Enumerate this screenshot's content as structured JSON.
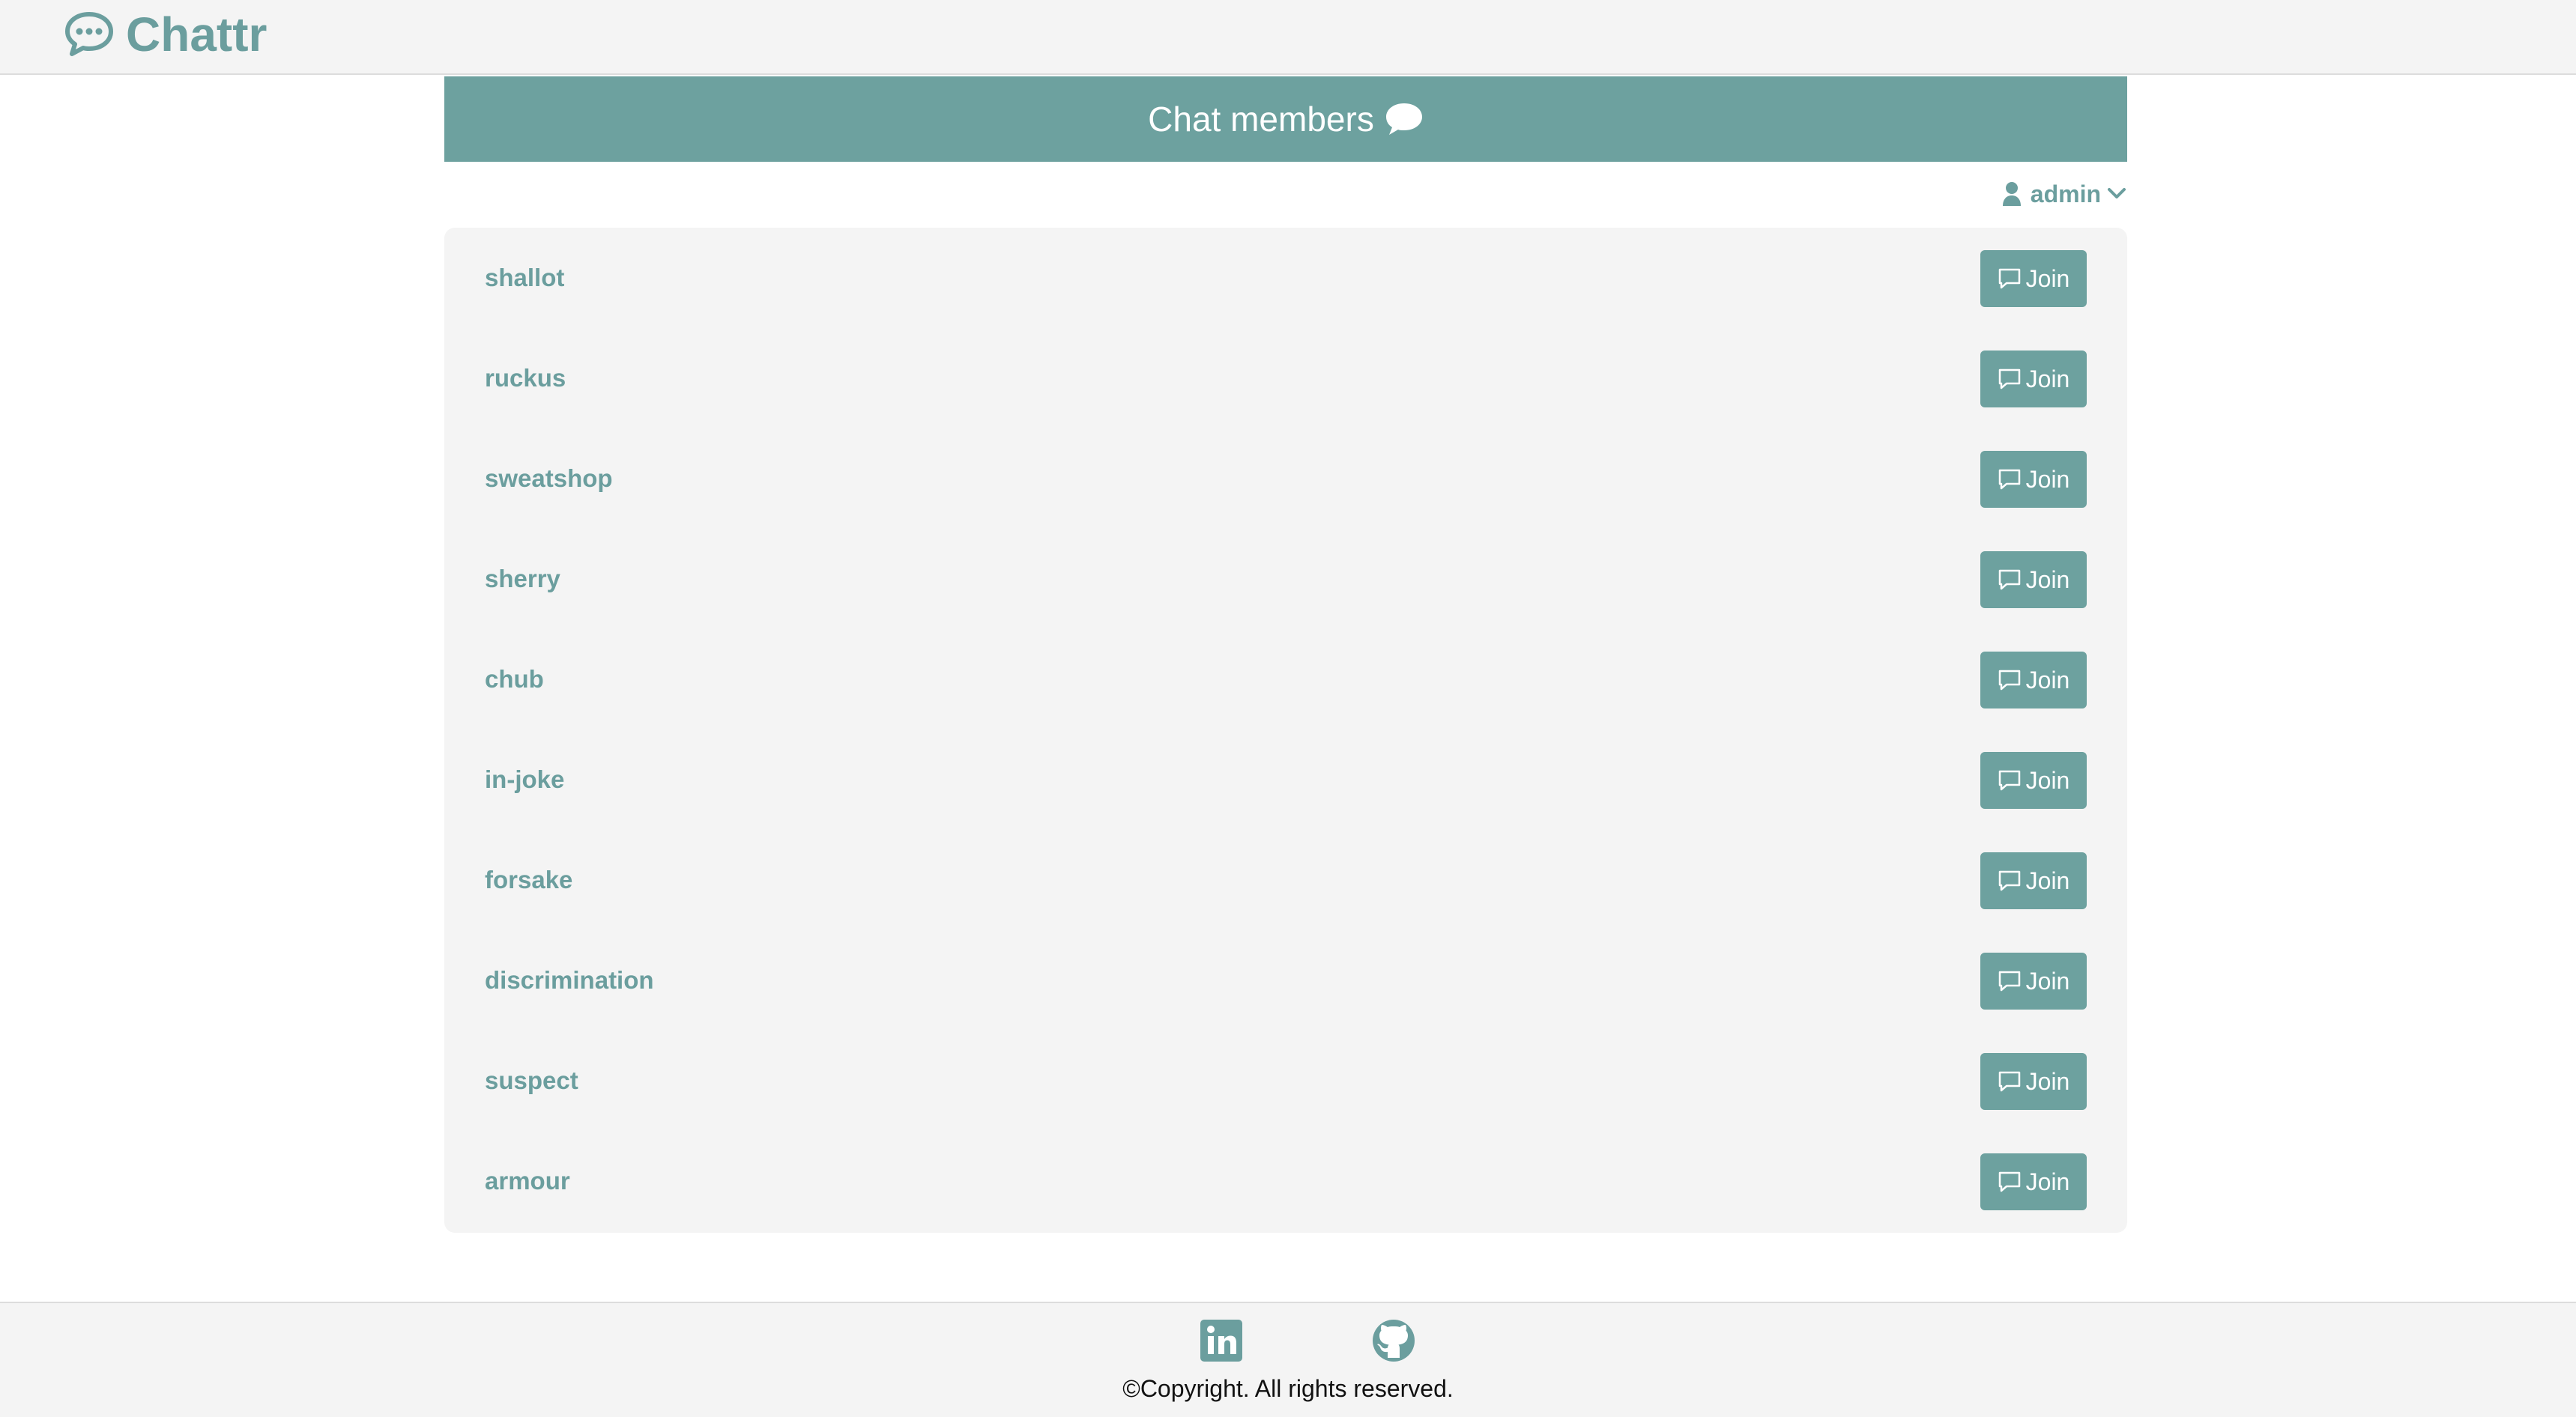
{
  "brand": {
    "name": "Chattr",
    "icon": "chat-bubble-dots-icon"
  },
  "header": {
    "title": "Chat members",
    "icon": "speech-bubble-icon"
  },
  "user_menu": {
    "username": "admin",
    "icon": "user-icon",
    "caret_icon": "chevron-down-icon"
  },
  "members": [
    {
      "name": "shallot",
      "action": "Join"
    },
    {
      "name": "ruckus",
      "action": "Join"
    },
    {
      "name": "sweatshop",
      "action": "Join"
    },
    {
      "name": "sherry",
      "action": "Join"
    },
    {
      "name": "chub",
      "action": "Join"
    },
    {
      "name": "in-joke",
      "action": "Join"
    },
    {
      "name": "forsake",
      "action": "Join"
    },
    {
      "name": "discrimination",
      "action": "Join"
    },
    {
      "name": "suspect",
      "action": "Join"
    },
    {
      "name": "armour",
      "action": "Join"
    }
  ],
  "footer": {
    "links": [
      {
        "name": "LinkedIn",
        "icon": "linkedin-icon"
      },
      {
        "name": "GitHub",
        "icon": "github-icon"
      }
    ],
    "copyright": "©Copyright. All rights reserved."
  },
  "colors": {
    "accent": "#6da19f",
    "brand_text": "#6b9e9e",
    "surface": "#f4f4f4",
    "background": "#ffffff"
  }
}
